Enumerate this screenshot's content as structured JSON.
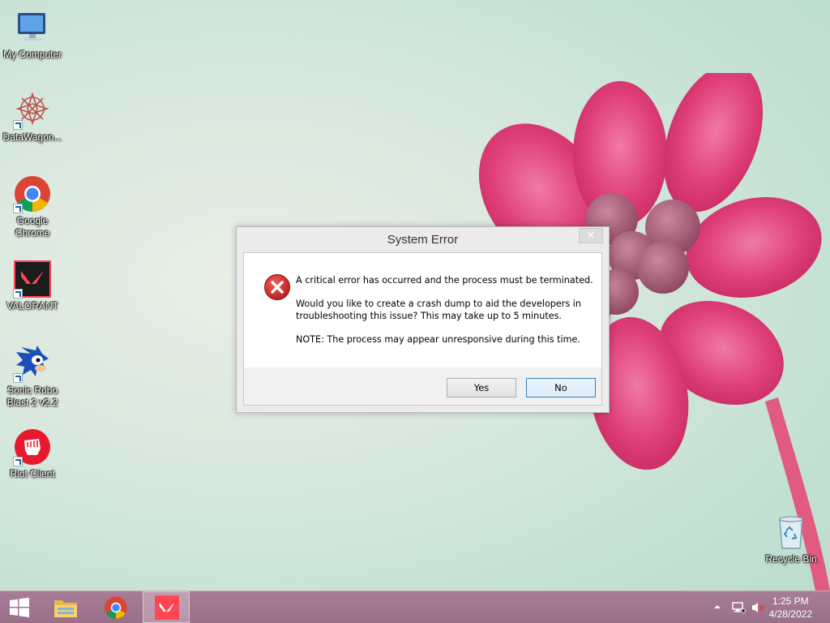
{
  "desktop": {
    "icons": [
      {
        "label": "My Computer",
        "icon": "computer-icon"
      },
      {
        "label": "DataWagon...",
        "icon": "datawagon-icon"
      },
      {
        "label": "Google Chrome",
        "icon": "chrome-icon"
      },
      {
        "label": "VALORANT",
        "icon": "valorant-icon"
      },
      {
        "label": "Sonic Robo Blast 2 v2.2",
        "icon": "sonic-icon"
      },
      {
        "label": "Riot Client",
        "icon": "riot-client-icon"
      }
    ],
    "recycle_bin": {
      "label": "Recycle Bin",
      "icon": "recycle-bin-icon"
    }
  },
  "dialog": {
    "title": "System Error",
    "close_glyph": "✕",
    "icon": "error-icon",
    "message_1": "A critical error has occurred and the process must be terminated.",
    "message_2": "Would you like to create a crash dump to aid the developers in troubleshooting this issue? This may take up to 5 minutes.",
    "message_3": "NOTE: The process may appear unresponsive during this time.",
    "yes_label": "Yes",
    "no_label": "No"
  },
  "taskbar": {
    "pinned": [
      "windows-start-icon",
      "file-explorer-icon",
      "chrome-icon",
      "valorant-icon"
    ],
    "tray": {
      "time": "1:25 PM",
      "date": "4/28/2022",
      "icons": [
        "show-hidden-icons-icon",
        "network-icon",
        "volume-muted-icon"
      ]
    }
  },
  "colors": {
    "taskbar": "#9f7490",
    "flower": "#e2457f",
    "error_red": "#d32f2f",
    "valorant_red": "#ff4655",
    "default_button_border": "#3c7fb1"
  }
}
